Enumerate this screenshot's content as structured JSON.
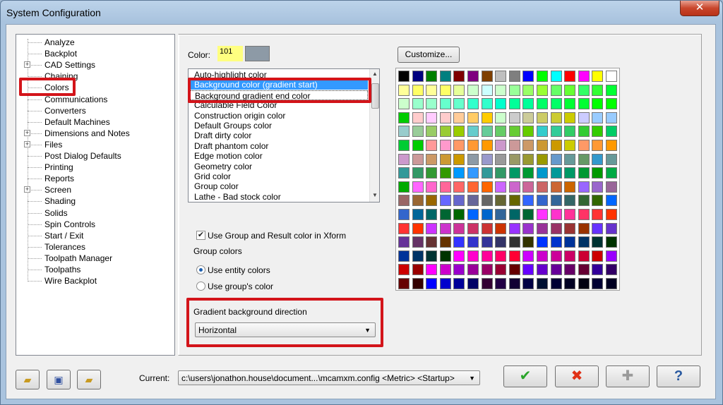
{
  "window": {
    "title": "System Configuration",
    "close_glyph": "✕"
  },
  "tree": {
    "items": [
      {
        "label": "Analyze",
        "expandable": false
      },
      {
        "label": "Backplot",
        "expandable": false
      },
      {
        "label": "CAD Settings",
        "expandable": true
      },
      {
        "label": "Chaining",
        "expandable": false
      },
      {
        "label": "Colors",
        "expandable": false,
        "selected": true
      },
      {
        "label": "Communications",
        "expandable": false
      },
      {
        "label": "Converters",
        "expandable": false
      },
      {
        "label": "Default Machines",
        "expandable": false
      },
      {
        "label": "Dimensions and Notes",
        "expandable": true
      },
      {
        "label": "Files",
        "expandable": true
      },
      {
        "label": "Post Dialog Defaults",
        "expandable": false
      },
      {
        "label": "Printing",
        "expandable": false
      },
      {
        "label": "Reports",
        "expandable": false
      },
      {
        "label": "Screen",
        "expandable": true
      },
      {
        "label": "Shading",
        "expandable": false
      },
      {
        "label": "Solids",
        "expandable": false
      },
      {
        "label": "Spin Controls",
        "expandable": false
      },
      {
        "label": "Start / Exit",
        "expandable": false
      },
      {
        "label": "Tolerances",
        "expandable": false
      },
      {
        "label": "Toolpath Manager",
        "expandable": false
      },
      {
        "label": "Toolpaths",
        "expandable": false
      },
      {
        "label": "Wire Backplot",
        "expandable": false
      }
    ]
  },
  "color": {
    "label": "Color:",
    "value": "101",
    "swatch_color": "#8d9aa6"
  },
  "color_list": {
    "items": [
      "Auto-highlight color",
      "Background color (gradient start)",
      "Background gradient end color",
      "Calculable Field Color",
      "Construction origin color",
      "Default Groups color",
      "Draft dirty color",
      "Draft phantom color",
      "Edge motion color",
      "Geometry color",
      "Grid color",
      "Group color",
      "Lathe - Bad stock color"
    ],
    "selected_index": 1,
    "focused_index": 2
  },
  "xform_checkbox": {
    "label": "Use Group and Result color in Xform",
    "checked": true
  },
  "group_colors": {
    "label": "Group colors",
    "options": [
      {
        "label": "Use entity colors",
        "checked": true
      },
      {
        "label": "Use group's color",
        "checked": false
      }
    ]
  },
  "gradient": {
    "label": "Gradient background direction",
    "value": "Horizontal"
  },
  "customize_button": {
    "label": "Customize..."
  },
  "palette": {
    "rows": [
      [
        "#000000",
        "#00007f",
        "#007f00",
        "#007f7f",
        "#7f0000",
        "#7f007f",
        "#7f3f00",
        "#bfbfbf",
        "#7f7f7f",
        "#0000ff",
        "#00ff00",
        "#00ffff",
        "#ff0000",
        "#ff00ff",
        "#ffff00",
        "#ffffff"
      ],
      [
        "#ffff99",
        "#ffff66",
        "#ffff99",
        "#ffff66",
        "#e6ff99",
        "#ccffcc",
        "#ccffff",
        "#ccffcc",
        "#99ff99",
        "#99ff66",
        "#99ff33",
        "#66ff66",
        "#66ff33",
        "#33ff66",
        "#33ff33",
        "#00ff33"
      ],
      [
        "#ccffcc",
        "#99ffcc",
        "#99ffcc",
        "#66ffcc",
        "#66ffcc",
        "#33ffcc",
        "#33ffcc",
        "#00ffcc",
        "#00ff99",
        "#00ff99",
        "#00ff66",
        "#00ff66",
        "#00ff33",
        "#00ff33",
        "#00ff00",
        "#00ff00"
      ],
      [
        "#00cc00",
        "#ffcccc",
        "#ffccff",
        "#ffcccc",
        "#ffcc99",
        "#ffcc66",
        "#ffcc00",
        "#ccffcc",
        "#cccccc",
        "#cccc99",
        "#cccc66",
        "#cccc33",
        "#cccc00",
        "#ccccff",
        "#99ccff",
        "#99ccff"
      ],
      [
        "#99cccc",
        "#99cc99",
        "#99cc66",
        "#99cc33",
        "#99cc00",
        "#66cccc",
        "#66cc99",
        "#66cc66",
        "#66cc33",
        "#66cc00",
        "#33cccc",
        "#33cc99",
        "#33cc66",
        "#33cc33",
        "#33cc00",
        "#00cc66"
      ],
      [
        "#00cc33",
        "#00cc00",
        "#ff9999",
        "#ff99cc",
        "#ff9966",
        "#ff9933",
        "#ff9900",
        "#cc99cc",
        "#cc9999",
        "#cc9966",
        "#cc9933",
        "#cc9900",
        "#cccc00",
        "#ff9966",
        "#ff9933",
        "#ff9900"
      ],
      [
        "#cc99cc",
        "#cc9999",
        "#cc9966",
        "#cc9933",
        "#cc9900",
        "#8d9aa6",
        "#9999cc",
        "#999999",
        "#999966",
        "#999933",
        "#999900",
        "#6699cc",
        "#669999",
        "#669966",
        "#3399cc",
        "#669999"
      ],
      [
        "#339999",
        "#339966",
        "#339933",
        "#339900",
        "#0099ff",
        "#3399ff",
        "#339999",
        "#339966",
        "#009966",
        "#009933",
        "#0099cc",
        "#009999",
        "#009966",
        "#009933",
        "#009900",
        "#00aa44"
      ],
      [
        "#00aa00",
        "#ff66ff",
        "#ff66cc",
        "#ff6699",
        "#ff6666",
        "#ff6633",
        "#ff6600",
        "#cc66ff",
        "#cc66cc",
        "#cc6699",
        "#cc6666",
        "#cc6633",
        "#cc6600",
        "#9966ff",
        "#9966cc",
        "#996699"
      ],
      [
        "#996666",
        "#996633",
        "#996600",
        "#6666ff",
        "#6666cc",
        "#666699",
        "#666666",
        "#666633",
        "#666600",
        "#3366ff",
        "#3366cc",
        "#336699",
        "#336666",
        "#336633",
        "#336600",
        "#0066ff"
      ],
      [
        "#3366cc",
        "#006699",
        "#006666",
        "#006633",
        "#006600",
        "#0066ff",
        "#0066cc",
        "#336699",
        "#006666",
        "#006633",
        "#ff33ff",
        "#ff33cc",
        "#ff3399",
        "#ff3366",
        "#ff3333",
        "#ff3300"
      ],
      [
        "#ff3333",
        "#ff3300",
        "#cc33ff",
        "#cc33cc",
        "#cc3399",
        "#cc3366",
        "#cc3333",
        "#cc3300",
        "#9933ff",
        "#9933cc",
        "#993399",
        "#993366",
        "#993333",
        "#993300",
        "#6633ff",
        "#6633cc"
      ],
      [
        "#663399",
        "#663366",
        "#663333",
        "#663300",
        "#3333ff",
        "#3333cc",
        "#333399",
        "#333366",
        "#333333",
        "#333300",
        "#0033ff",
        "#0033cc",
        "#003399",
        "#003366",
        "#003333",
        "#003300"
      ],
      [
        "#003399",
        "#003366",
        "#003333",
        "#003300",
        "#ff00ff",
        "#ff00cc",
        "#ff0099",
        "#ff0066",
        "#ff0033",
        "#cc00ff",
        "#cc00cc",
        "#cc0099",
        "#cc0066",
        "#cc0033",
        "#cc0000",
        "#9900ff"
      ],
      [
        "#cc0000",
        "#990000",
        "#ff00ff",
        "#cc00cc",
        "#9900cc",
        "#990099",
        "#990066",
        "#990033",
        "#660000",
        "#6600ff",
        "#6600cc",
        "#660099",
        "#660066",
        "#660033",
        "#330099",
        "#330066"
      ],
      [
        "#660000",
        "#330000",
        "#0000ff",
        "#0000cc",
        "#000099",
        "#000066",
        "#330033",
        "#220044",
        "#110033",
        "#000044",
        "#001133",
        "#000033",
        "#000022",
        "#000011",
        "#000033",
        "#000022"
      ]
    ]
  },
  "footer": {
    "current_label": "Current:",
    "current_value": "c:\\users\\jonathon.house\\document...\\mcamxm.config <Metric> <Startup>",
    "ok_glyph": "✔",
    "cancel_glyph": "✖",
    "apply_glyph": "✚",
    "help_glyph": "?"
  }
}
